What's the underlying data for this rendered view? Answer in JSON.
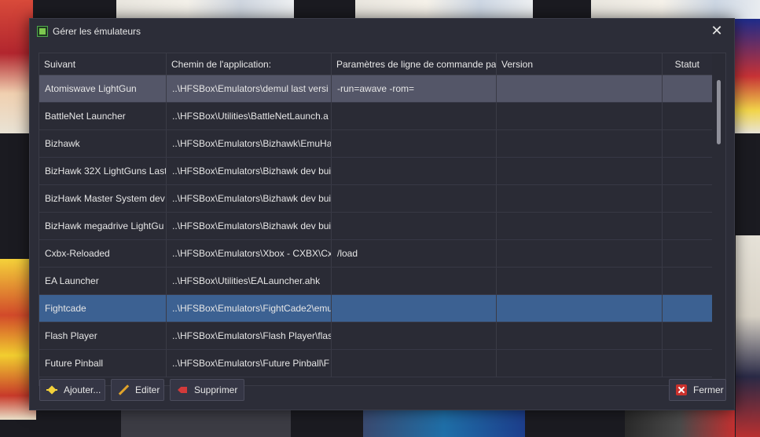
{
  "window": {
    "title": "Gérer les émulateurs",
    "close_glyph": "✕"
  },
  "table": {
    "columns": [
      "Suivant",
      "Chemin de l'application:",
      "Paramètres de ligne de commande pa",
      "Version",
      "Statut"
    ],
    "rows": [
      {
        "name": "Atomiswave LightGun",
        "path": "..\\HFSBox\\Emulators\\demul last versi",
        "params": "-run=awave -rom=",
        "version": "",
        "status": "",
        "selected": "grey"
      },
      {
        "name": "BattleNet Launcher",
        "path": "..\\HFSBox\\Utilities\\BattleNetLaunch.a",
        "params": "",
        "version": "",
        "status": ""
      },
      {
        "name": "Bizhawk",
        "path": "..\\HFSBox\\Emulators\\Bizhawk\\EmuHa",
        "params": "",
        "version": "",
        "status": ""
      },
      {
        "name": "BizHawk 32X LightGuns Last",
        "path": "..\\HFSBox\\Emulators\\Bizhawk dev bui",
        "params": "",
        "version": "",
        "status": ""
      },
      {
        "name": "BizHawk Master System dev",
        "path": "..\\HFSBox\\Emulators\\Bizhawk dev bui",
        "params": "",
        "version": "",
        "status": ""
      },
      {
        "name": "BizHawk megadrive LightGu",
        "path": "..\\HFSBox\\Emulators\\Bizhawk dev bui",
        "params": "",
        "version": "",
        "status": ""
      },
      {
        "name": "Cxbx-Reloaded",
        "path": "..\\HFSBox\\Emulators\\Xbox - CXBX\\Cx",
        "params": "/load",
        "version": "",
        "status": ""
      },
      {
        "name": "EA Launcher",
        "path": "..\\HFSBox\\Utilities\\EALauncher.ahk",
        "params": "",
        "version": "",
        "status": ""
      },
      {
        "name": "Fightcade",
        "path": "..\\HFSBox\\Emulators\\FightCade2\\emu",
        "params": "",
        "version": "",
        "status": "",
        "selected": "blue"
      },
      {
        "name": "Flash Player",
        "path": "..\\HFSBox\\Emulators\\Flash Player\\flas",
        "params": "",
        "version": "",
        "status": ""
      },
      {
        "name": "Future Pinball",
        "path": "..\\HFSBox\\Emulators\\Future Pinball\\F",
        "params": "",
        "version": "",
        "status": ""
      }
    ]
  },
  "buttons": {
    "add": "Ajouter...",
    "edit": "Editer",
    "delete": "Supprimer",
    "close": "Fermer"
  },
  "icons": {
    "window": "app-icon",
    "add": "add-star-icon",
    "edit": "pencil-icon",
    "delete": "delete-icon",
    "close": "close-red-icon"
  },
  "colors": {
    "dialog_bg": "#2c2d38",
    "row_selected_grey": "#545668",
    "row_selected_blue": "#3c6192",
    "text": "#e6e6e6"
  }
}
